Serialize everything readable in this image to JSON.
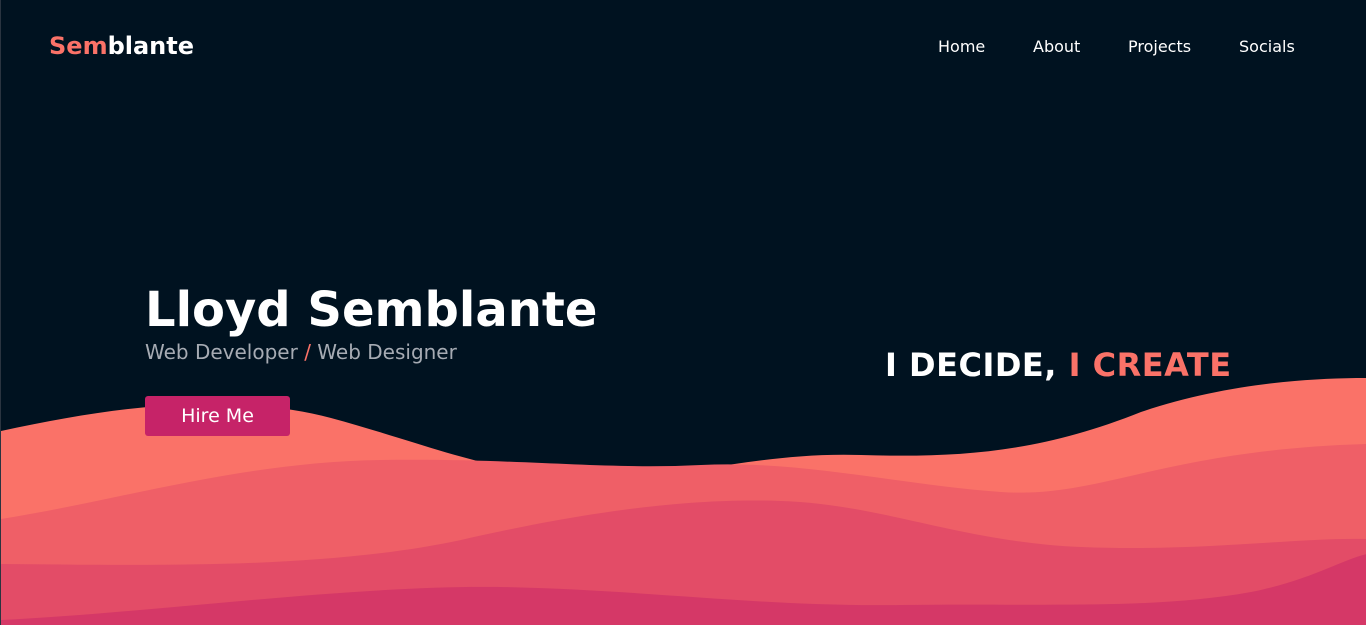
{
  "brand": {
    "logo_accent": "Sem",
    "logo_rest": "blante"
  },
  "nav": {
    "items": [
      "Home",
      "About",
      "Projects",
      "Socials"
    ]
  },
  "hero": {
    "name": "Lloyd Semblante",
    "role_primary": "Web Developer",
    "role_separator": "/",
    "role_secondary": "Web Designer",
    "cta_label": "Hire Me",
    "tagline_part1": "I DECIDE,",
    "tagline_part2": "I CREATE"
  },
  "colors": {
    "background": "#001220",
    "accent": "#fa7268",
    "button": "#c62368",
    "wave_layers": [
      "#fa7268",
      "#ef5f67",
      "#e34c67",
      "#d53867"
    ]
  }
}
